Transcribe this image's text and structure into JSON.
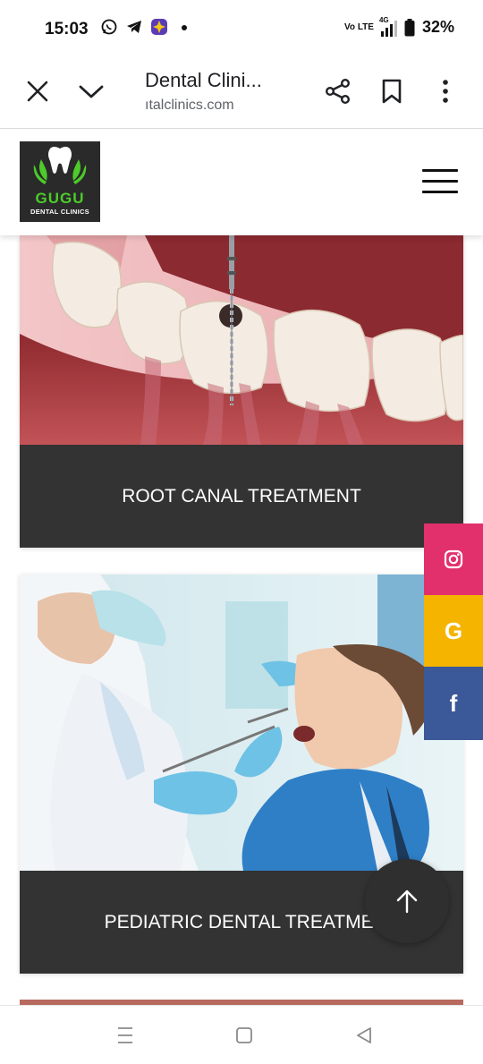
{
  "status_bar": {
    "time": "15:03",
    "left_icons": [
      "whatsapp-icon",
      "telegram-icon",
      "app-icon",
      "notification-dot-icon"
    ],
    "network_label": "Vo LTE",
    "network_type": "4G",
    "battery": "32%"
  },
  "browser": {
    "title": "Dental Clini...",
    "url": "ıtalclinics.com",
    "buttons": [
      "close-icon",
      "chevron-down-icon",
      "share-icon",
      "bookmark-icon",
      "more-vert-icon"
    ]
  },
  "site": {
    "logo_brand": "GUGU",
    "logo_sub": "DENTAL CLINICS",
    "brand_green": "#4ccb2a"
  },
  "cards": [
    {
      "caption": "ROOT CANAL TREATMENT"
    },
    {
      "caption": "PEDIATRIC DENTAL TREATMEI"
    }
  ],
  "social": [
    {
      "name": "instagram",
      "color": "#e1306c"
    },
    {
      "name": "google",
      "color": "#f4b400",
      "glyph": "G"
    },
    {
      "name": "facebook",
      "color": "#3b5998",
      "glyph": "f"
    }
  ],
  "colors": {
    "caption_bg": "#333333",
    "accent_pink": "#e1306c",
    "accent_gold": "#f4b400",
    "accent_blue": "#3b5998"
  }
}
